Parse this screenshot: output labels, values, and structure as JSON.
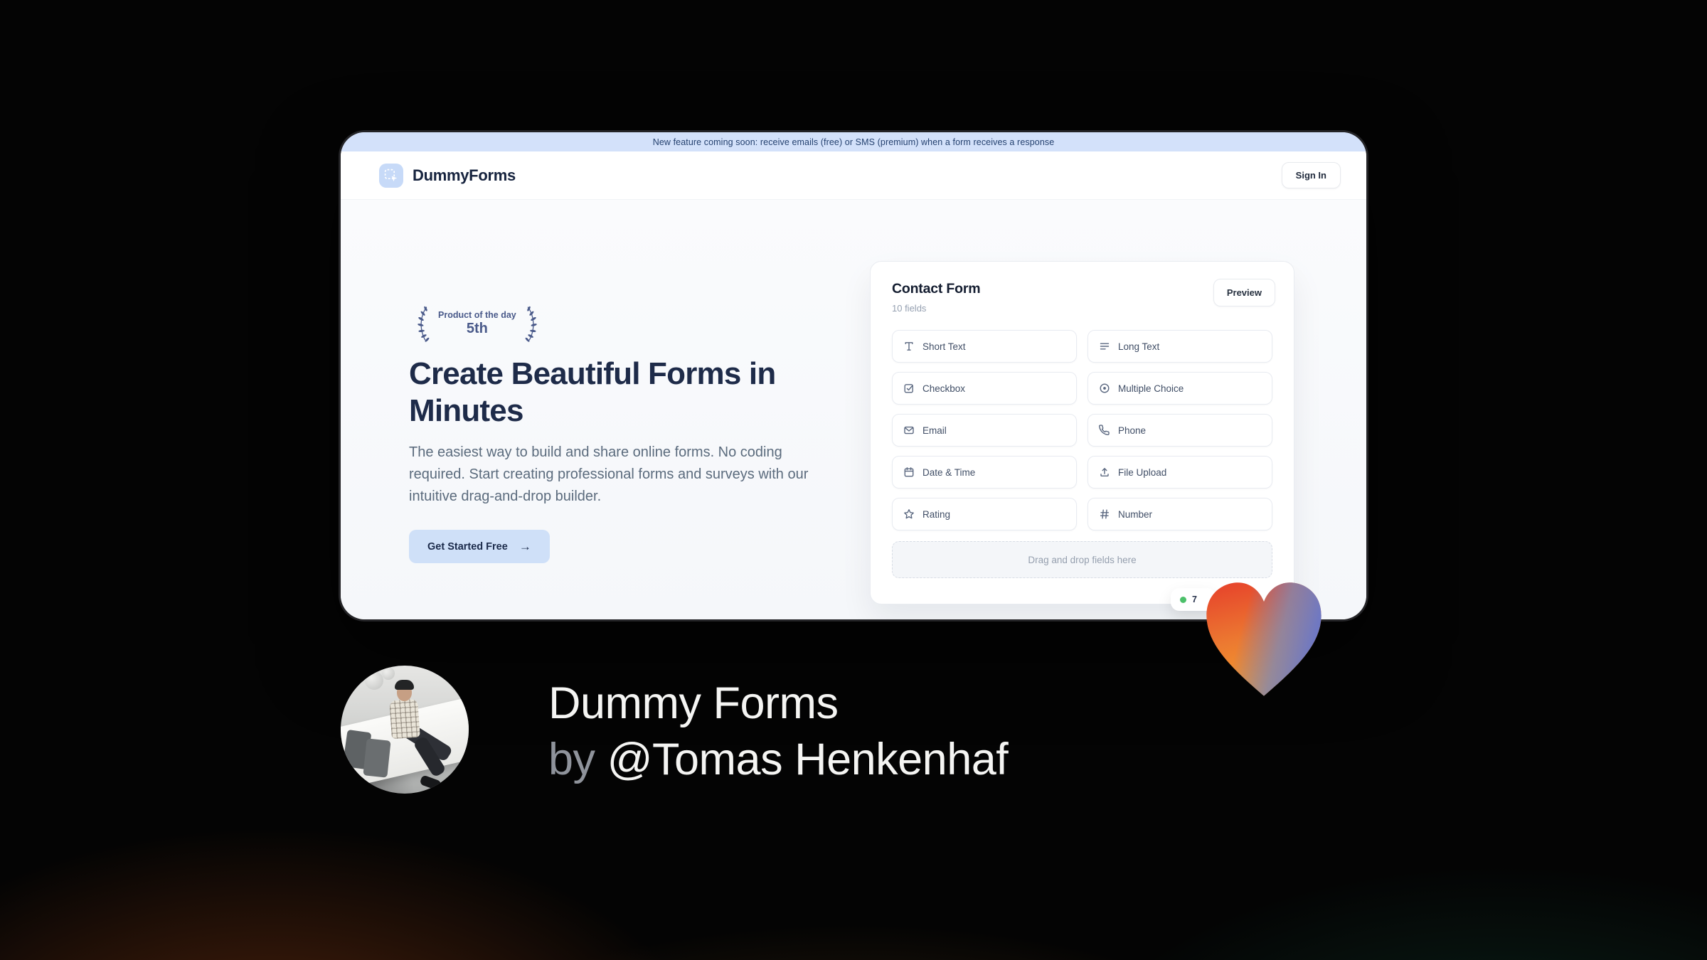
{
  "banner": {
    "text": "New feature coming soon: receive emails (free) or SMS (premium) when a form receives a response"
  },
  "header": {
    "brand": "DummyForms",
    "logo_icon": "dashed-selection-cursor-icon",
    "sign_in_label": "Sign In"
  },
  "hero": {
    "award_badge": {
      "line1": "Product of the day",
      "line2": "5th",
      "left_icon": "laurel-left-icon",
      "right_icon": "laurel-right-icon"
    },
    "headline": "Create Beautiful Forms in Minutes",
    "description": "The easiest way to build and share online forms. No coding required. Start creating professional forms and surveys with our intuitive drag-and-drop builder.",
    "cta_label": "Get Started Free",
    "cta_icon_glyph": "→"
  },
  "form_builder": {
    "title": "Contact Form",
    "subtitle": "10 fields",
    "preview_label": "Preview",
    "fields": [
      {
        "label": "Short Text",
        "icon": "text-icon"
      },
      {
        "label": "Long Text",
        "icon": "align-lines-icon"
      },
      {
        "label": "Checkbox",
        "icon": "checkbox-icon"
      },
      {
        "label": "Multiple Choice",
        "icon": "radio-icon"
      },
      {
        "label": "Email",
        "icon": "envelope-icon"
      },
      {
        "label": "Phone",
        "icon": "phone-icon"
      },
      {
        "label": "Date & Time",
        "icon": "calendar-icon"
      },
      {
        "label": "File Upload",
        "icon": "upload-icon"
      },
      {
        "label": "Rating",
        "icon": "star-icon"
      },
      {
        "label": "Number",
        "icon": "hash-icon"
      }
    ],
    "dropzone_text": "Drag and drop fields here",
    "responses_badge": {
      "text": "7",
      "dot_color": "#4cc06a"
    }
  },
  "footer": {
    "title": "Dummy Forms",
    "byline_prefix": "by",
    "author_handle": "@Tomas Henkenhaf"
  },
  "colors": {
    "accent_blue": "#cfe0f8",
    "banner_bg": "#d3e1fa",
    "navy": "#1e2b49",
    "heart_red": "#e6402b",
    "heart_orange": "#f59d2c",
    "heart_purple": "#6f78c2",
    "badge_green": "#4cc06a"
  }
}
